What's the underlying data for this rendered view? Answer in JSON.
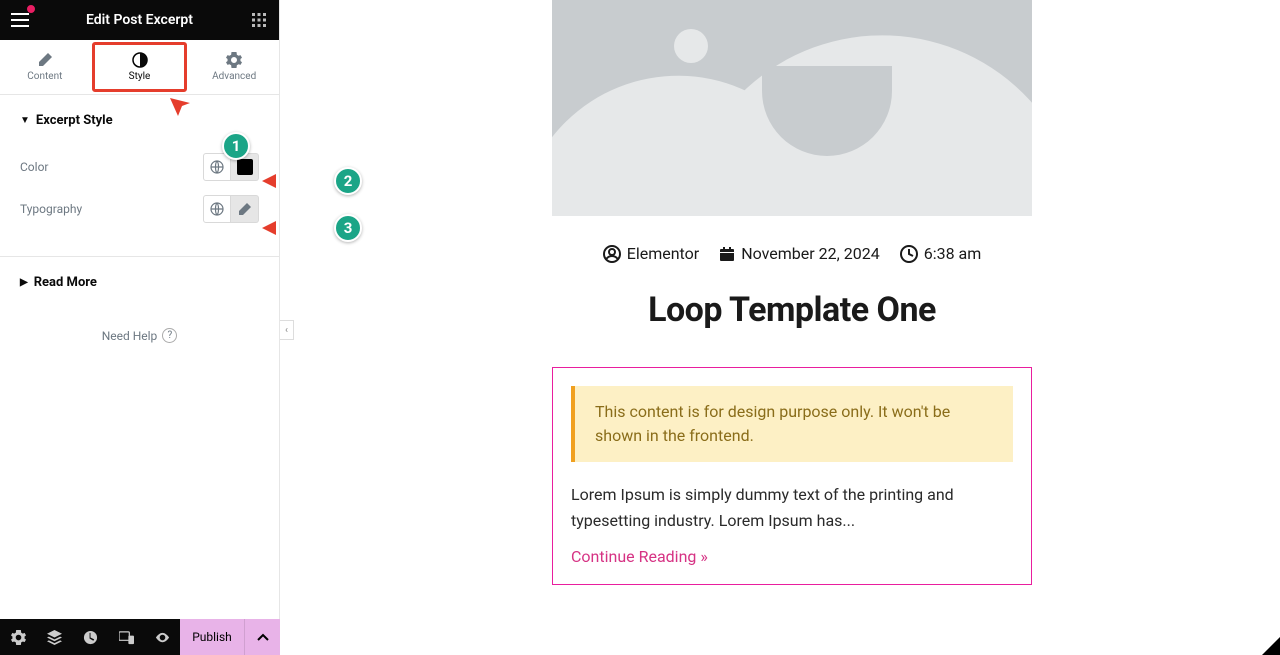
{
  "header": {
    "title": "Edit Post Excerpt"
  },
  "tabs": {
    "content": "Content",
    "style": "Style",
    "advanced": "Advanced"
  },
  "sections": {
    "excerpt_style": {
      "title": "Excerpt Style",
      "color_label": "Color",
      "typography_label": "Typography"
    },
    "read_more": {
      "title": "Read More"
    }
  },
  "help": {
    "label": "Need Help"
  },
  "bottom": {
    "publish": "Publish"
  },
  "preview": {
    "meta": {
      "author": "Elementor",
      "date": "November 22, 2024",
      "time": "6:38 am"
    },
    "title": "Loop Template One",
    "notice": "This content is for design purpose only. It won't be shown in the frontend.",
    "excerpt": "Lorem Ipsum is simply dummy text of the printing and typesetting industry. Lorem Ipsum has...",
    "read_more": "Continue Reading »"
  },
  "annotations": {
    "one": "1",
    "two": "2",
    "three": "3"
  }
}
